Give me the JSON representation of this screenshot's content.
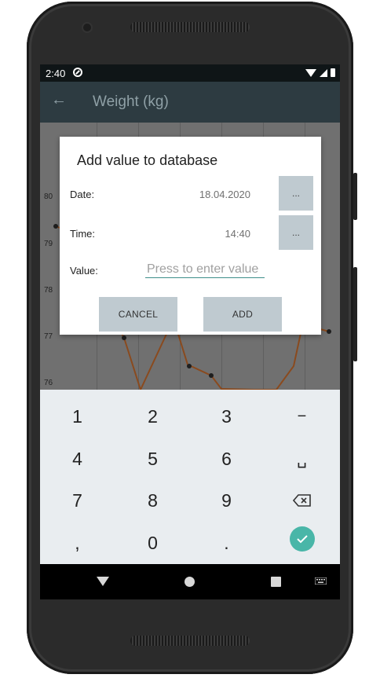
{
  "status_bar": {
    "time": "2:40"
  },
  "app_bar": {
    "back_icon": "arrow-left-icon",
    "title": "Weight (kg)"
  },
  "chart": {
    "y_tick_labels": [
      "80",
      "79",
      "78",
      "77",
      "76"
    ]
  },
  "dialog": {
    "title": "Add value to database",
    "date_label": "Date:",
    "date_value": "18.04.2020",
    "date_button": "...",
    "time_label": "Time:",
    "time_value": "14:40",
    "time_button": "...",
    "value_label": "Value:",
    "value_placeholder": "Press to enter value",
    "cancel_label": "CANCEL",
    "add_label": "ADD"
  },
  "keyboard": {
    "keys": [
      "1",
      "2",
      "3",
      "−",
      "4",
      "5",
      "6",
      "␣",
      "7",
      "8",
      "9",
      "backspace",
      ",",
      "0",
      ".",
      "done"
    ]
  },
  "colors": {
    "accent": "#49b6a8",
    "button_bg": "#bfcad0",
    "appbar_bg": "#2d3b41",
    "chart_line": "#a85a24"
  }
}
